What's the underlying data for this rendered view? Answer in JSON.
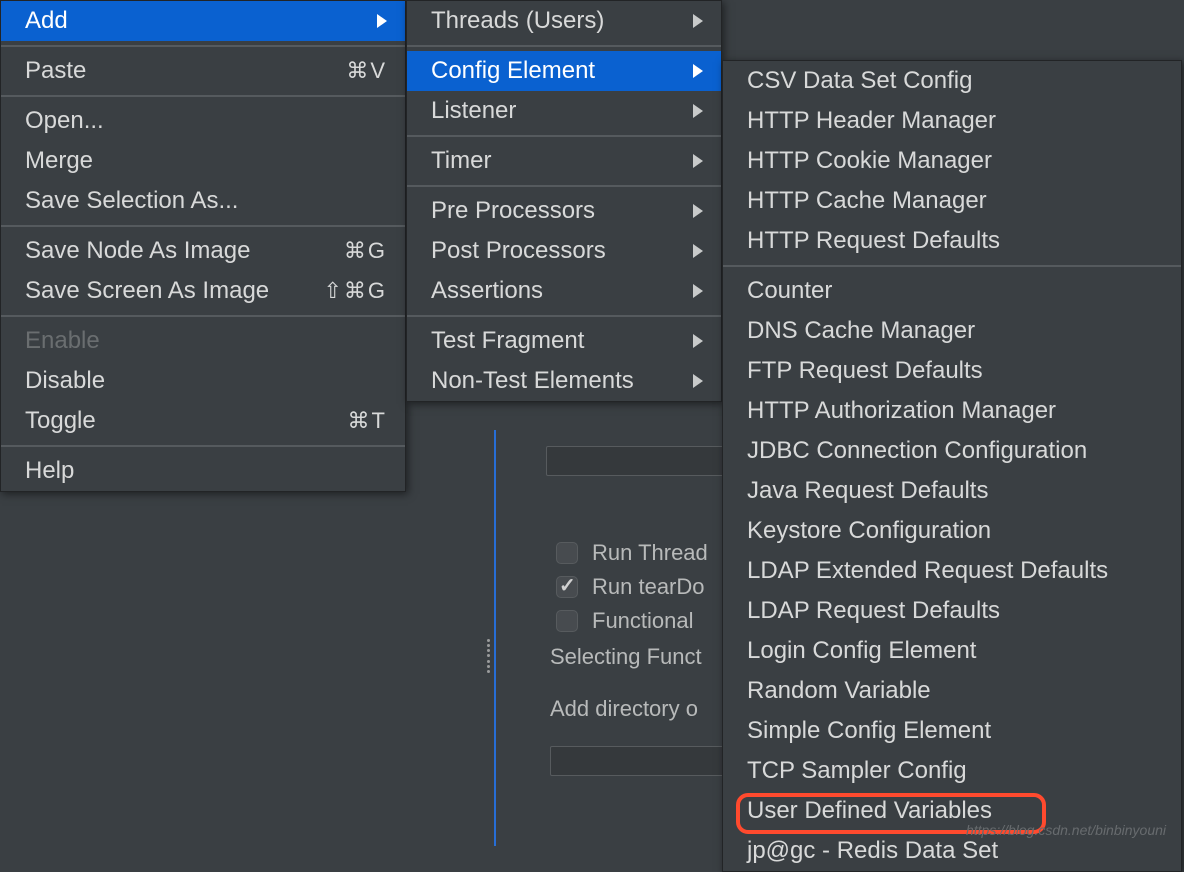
{
  "menu1": {
    "add": "Add",
    "paste": "Paste",
    "paste_sc": "⌘V",
    "open": "Open...",
    "merge": "Merge",
    "savesel": "Save Selection As...",
    "savenode": "Save Node As Image",
    "savenode_sc": "⌘G",
    "savescreen": "Save Screen As Image",
    "savescreen_sc": "⇧⌘G",
    "enable": "Enable",
    "disable": "Disable",
    "toggle": "Toggle",
    "toggle_sc": "⌘T",
    "help": "Help"
  },
  "menu2": {
    "threads": "Threads (Users)",
    "config": "Config Element",
    "listener": "Listener",
    "timer": "Timer",
    "pre": "Pre Processors",
    "post": "Post Processors",
    "assert": "Assertions",
    "frag": "Test Fragment",
    "nontest": "Non-Test Elements"
  },
  "menu3": {
    "csv": "CSV Data Set Config",
    "hheader": "HTTP Header Manager",
    "hcookie": "HTTP Cookie Manager",
    "hcache": "HTTP Cache Manager",
    "hreq": "HTTP Request Defaults",
    "counter": "Counter",
    "dns": "DNS Cache Manager",
    "ftp": "FTP Request Defaults",
    "hauth": "HTTP Authorization Manager",
    "jdbc": "JDBC Connection Configuration",
    "javareq": "Java Request Defaults",
    "keystore": "Keystore Configuration",
    "ldapext": "LDAP Extended Request Defaults",
    "ldapreq": "LDAP Request Defaults",
    "login": "Login Config Element",
    "random": "Random Variable",
    "simple": "Simple Config Element",
    "tcp": "TCP Sampler Config",
    "udv": "User Defined Variables",
    "redis": "jp@gc - Redis Data Set"
  },
  "bg": {
    "runthread": "Run Thread",
    "runtear": "Run tearDo",
    "func": "Functional",
    "select": "Selecting Funct",
    "adddir": "Add directory o"
  },
  "wm": "https://blog.csdn.net/binbinyouni"
}
